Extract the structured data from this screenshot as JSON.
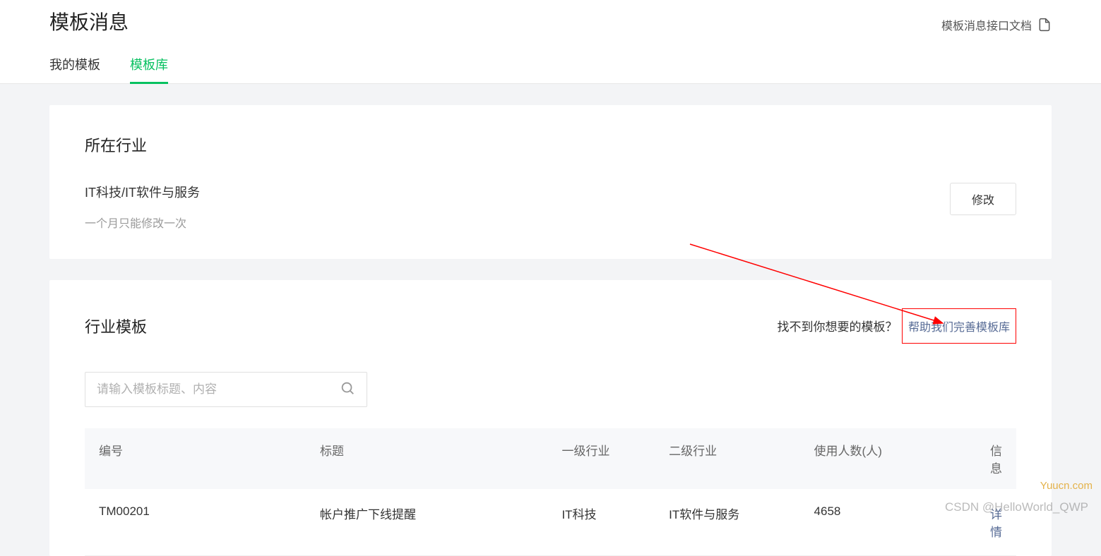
{
  "header": {
    "title": "模板消息",
    "doc_link": "模板消息接口文档"
  },
  "tabs": {
    "my_templates": "我的模板",
    "template_library": "模板库"
  },
  "industry_section": {
    "title": "所在行业",
    "value": "IT科技/IT软件与服务",
    "note": "一个月只能修改一次",
    "modify_button": "修改"
  },
  "templates_section": {
    "title": "行业模板",
    "help_prompt": "找不到你想要的模板？",
    "help_link": "帮助我们完善模板库",
    "search_placeholder": "请输入模板标题、内容"
  },
  "table": {
    "headers": {
      "id": "编号",
      "title": "标题",
      "industry1": "一级行业",
      "industry2": "二级行业",
      "users": "使用人数(人)",
      "info": "信息"
    },
    "rows": [
      {
        "id": "TM00201",
        "title": "帐户推广下线提醒",
        "industry1": "IT科技",
        "industry2": "IT软件与服务",
        "users": "4658",
        "info": "详情"
      }
    ]
  },
  "watermark": {
    "csdn": "CSDN @HelloWorld_QWP",
    "site": "Yuucn.com"
  }
}
